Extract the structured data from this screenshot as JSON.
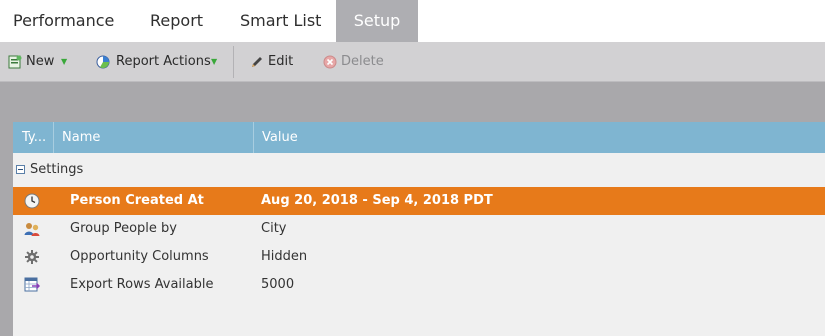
{
  "tabs": [
    {
      "label": "Performance",
      "active": false
    },
    {
      "label": "Report",
      "active": false
    },
    {
      "label": "Smart List",
      "active": false
    },
    {
      "label": "Setup",
      "active": true
    }
  ],
  "toolbar": {
    "new_label": "New",
    "report_actions_label": "Report Actions",
    "edit_label": "Edit",
    "delete_label": "Delete"
  },
  "grid": {
    "columns": [
      "Ty...",
      "Name",
      "Value"
    ],
    "group_label": "Settings",
    "rows": [
      {
        "icon": "clock-icon",
        "name": "Person Created At",
        "value": "Aug 20, 2018 - Sep 4, 2018 PDT",
        "selected": true
      },
      {
        "icon": "people-group-icon",
        "name": "Group People by",
        "value": "City",
        "selected": false
      },
      {
        "icon": "gear-icon",
        "name": "Opportunity Columns",
        "value": "Hidden",
        "selected": false
      },
      {
        "icon": "export-table-icon",
        "name": "Export Rows Available",
        "value": "5000",
        "selected": false
      }
    ]
  },
  "colors": {
    "selected_row": "#e77a1a",
    "header": "#7fb5d1",
    "active_tab": "#aeaeb2"
  }
}
